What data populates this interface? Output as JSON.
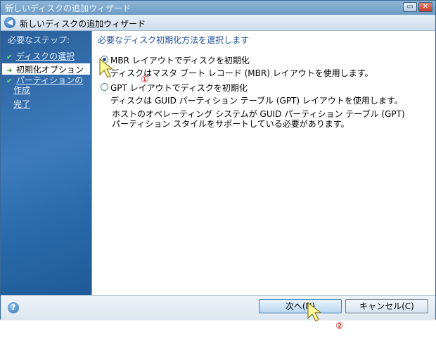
{
  "window": {
    "title": "新しいディスクの追加ウィザード",
    "minimize": "▭",
    "close": "✕"
  },
  "header": {
    "title": "新しいディスクの追加ウィザード",
    "back": "◀"
  },
  "sidebar": {
    "heading": "必要なステップ:",
    "steps": [
      {
        "mark": "✔",
        "label": "ディスクの選択"
      },
      {
        "mark": "➜",
        "label": "初期化オプション"
      },
      {
        "mark": "✔",
        "label_line1": "パーティションの",
        "label_line2": "作成"
      },
      {
        "label": "完了"
      }
    ]
  },
  "main": {
    "prompt": "必要なディスク初期化方法を選択します",
    "options": [
      {
        "label": "MBR レイアウトでディスクを初期化",
        "selected": true,
        "description": "ディスクはマスタ ブート レコード (MBR) レイアウトを使用します。"
      },
      {
        "label": "GPT レイアウトでディスクを初期化",
        "selected": false,
        "description": "ディスクは GUID パーティション テーブル (GPT) レイアウトを使用します。"
      }
    ],
    "note_line1": "ホストのオペレーティング システムが GUID パーティション テーブル (GPT)",
    "note_line2": "パーティション スタイルをサポートしている必要があります。"
  },
  "footer": {
    "help": "?",
    "next": "次へ(N)",
    "cancel": "キャンセル(C)"
  },
  "callouts": {
    "one": "①",
    "two": "②"
  }
}
